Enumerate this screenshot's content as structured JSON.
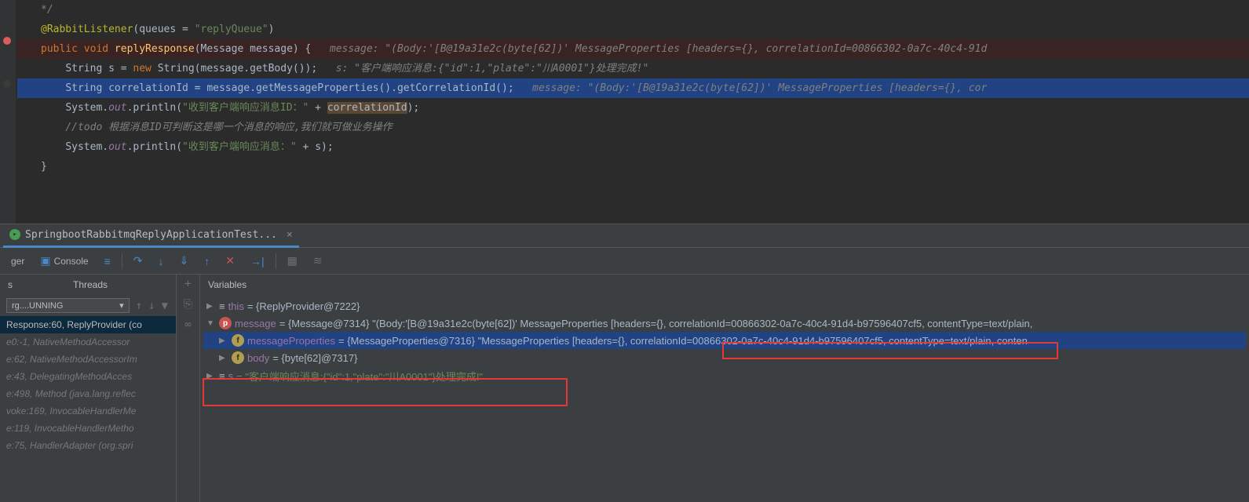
{
  "code": {
    "comment_end": "*/",
    "annotation": "@RabbitListener",
    "annotation_args": "(queues = \"replyQueue\")",
    "signature_kw": "public void ",
    "signature_method": "replyResponse",
    "signature_params": "(Message message) {",
    "inline_hint1": "   message: \"(Body:'[B@19a31e2c(byte[62])' MessageProperties [headers={}, correlationId=00866302-0a7c-40c4-91d",
    "line_s1": "String s = ",
    "line_s_new": "new ",
    "line_s2": "String(message.getBody());",
    "inline_hint2": "   s: \"客户端响应消息:{\"id\":1,\"plate\":\"川A0001\"}处理完成!\"",
    "line_corr": "String correlationId = message.getMessageProperties().getCorrelationId();",
    "inline_hint3": "   message: \"(Body:'[B@19a31e2c(byte[62])' MessageProperties [headers={}, cor",
    "sysout_prefix": "System.",
    "sysout_out": "out",
    "sysout_println": ".println(",
    "sysout_str1": "\"收到客户端响应消息ID：\"",
    "sysout_plus": " + ",
    "sysout_var1": "correlationId",
    "sysout_end": ");",
    "todo_comment": "//todo 根据消息ID可判断这是哪一个消息的响应,我们就可做业务操作",
    "sysout_str2": "\"收到客户端响应消息：\"",
    "sysout_var2": "s",
    "close_brace": "}"
  },
  "tab": {
    "label": "SpringbootRabbitmqReplyApplicationTest..."
  },
  "toolbar": {
    "debugger_tab": "ger",
    "console_tab": "Console"
  },
  "frames": {
    "tab_threads": "Threads",
    "thread_combo": "rg....UNNING",
    "items": [
      "Response:60, ReplyProvider (co",
      "e0:-1, NativeMethodAccessor",
      "e:62, NativeMethodAccessorIm",
      "e:43, DelegatingMethodAcces",
      "e:498, Method (java.lang.reflec",
      "voke:169, InvocableHandlerMe",
      "e:119, InvocableHandlerMetho",
      "e:75, HandlerAdapter (org.spri"
    ]
  },
  "vars": {
    "header": "Variables",
    "this_name": "this",
    "this_val": " = {ReplyProvider@7222}",
    "message_name": "message",
    "message_val": " = {Message@7314} \"(Body:'[B@19a31e2c(byte[62])' MessageProperties [headers={}, correlationId=00866302-0a7c-40c4-91d4-b97596407cf5, contentType=text/plain,",
    "mp_name": "messageProperties",
    "mp_val": " = {MessageProperties@7316} \"MessageProperties [headers={}, correlationId=00866302-0a7c-40c4-91d4-b97596407cf5, contentType=text/plain, conten",
    "body_name": "body",
    "body_val": " = {byte[62]@7317}",
    "s_name": "s",
    "s_val": " = \"客户端响应消息:{\"id\":1,\"plate\":\"川A0001\"}处理完成!\""
  }
}
